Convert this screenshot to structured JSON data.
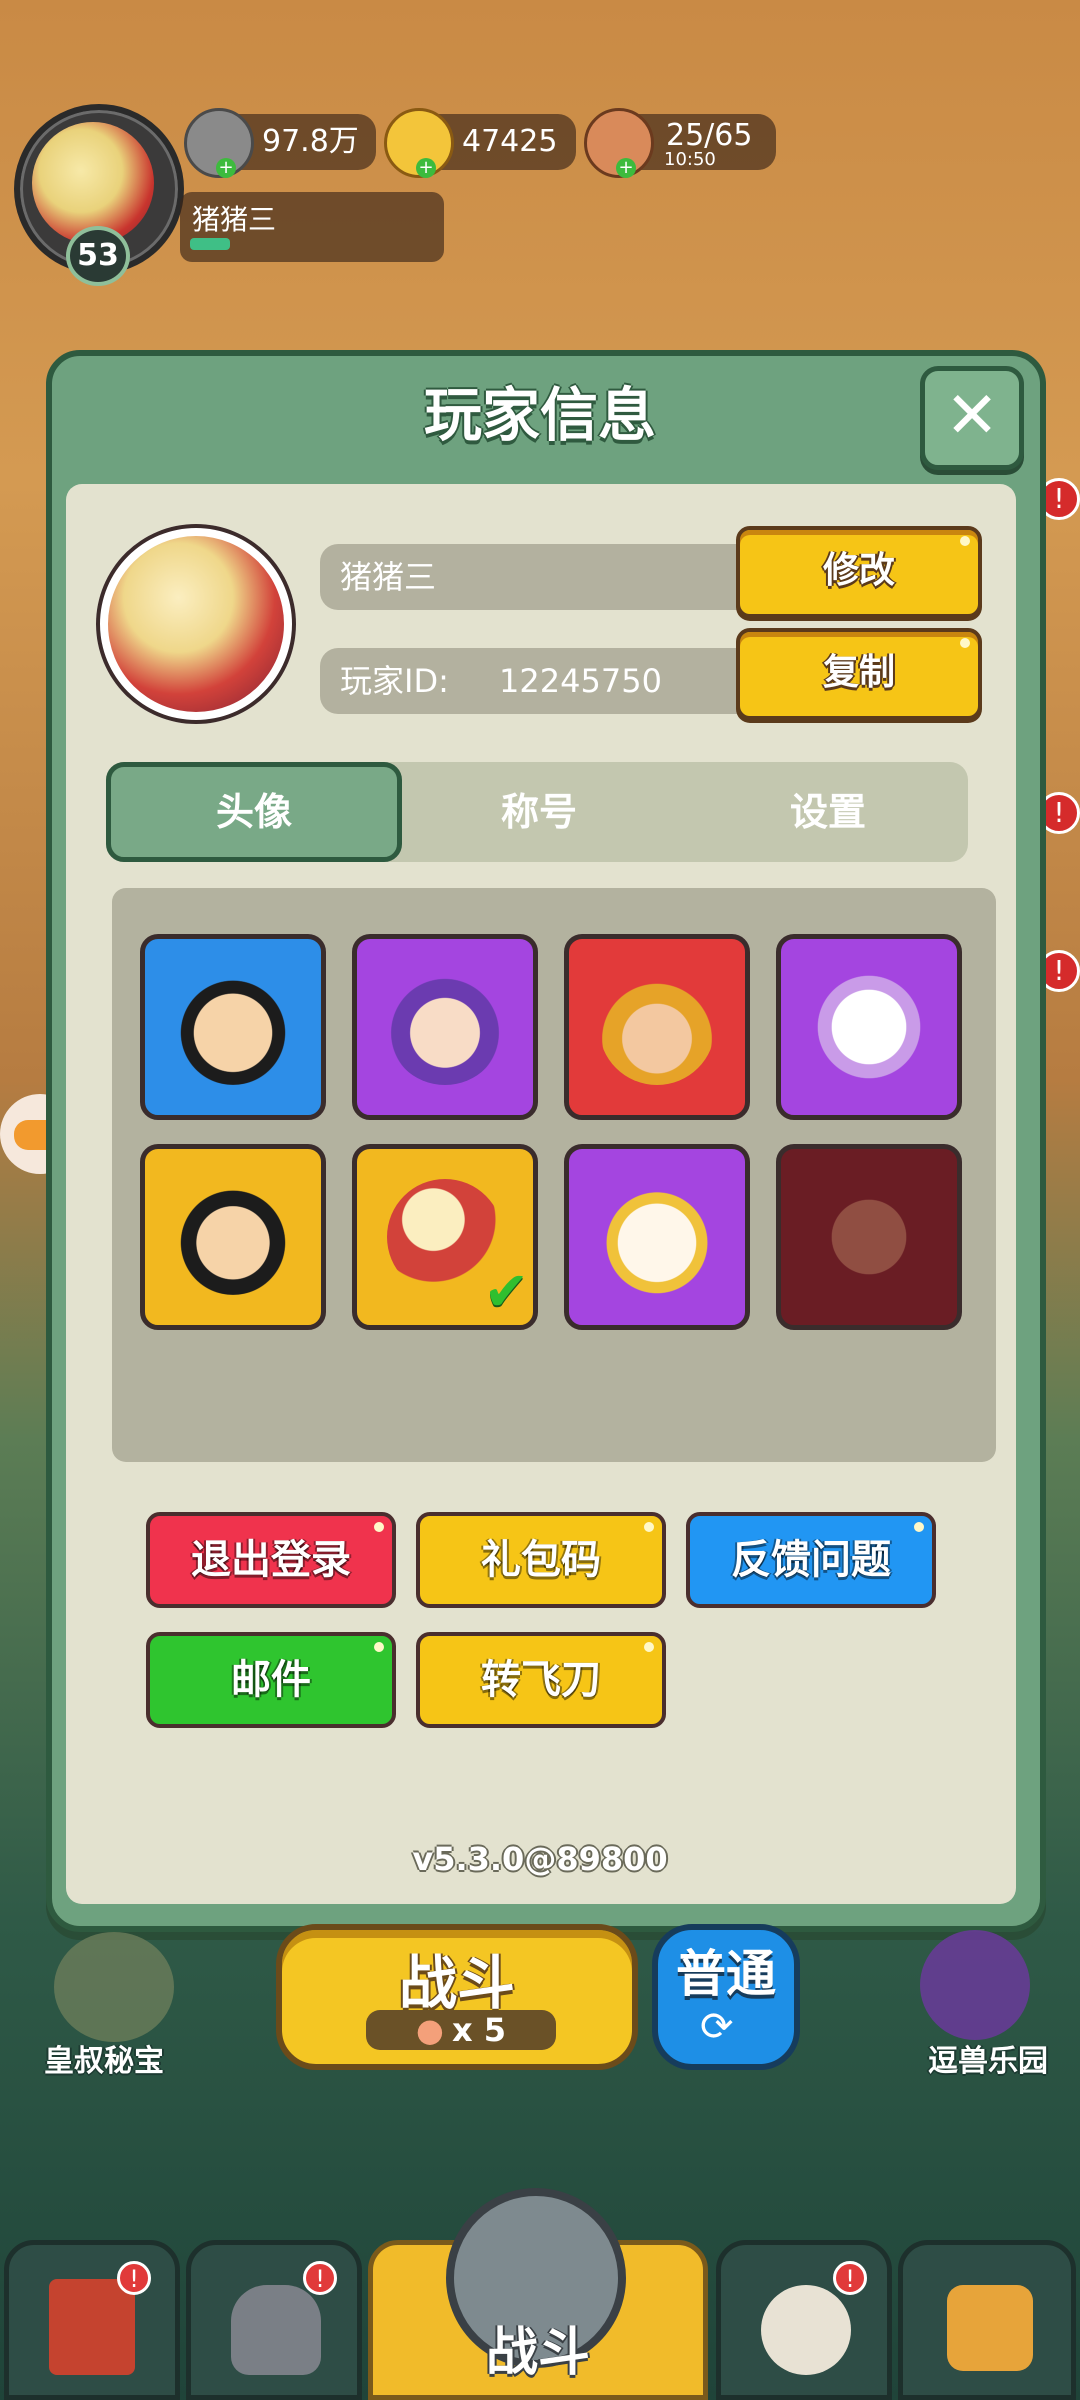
{
  "header": {
    "level": "53",
    "player_name": "猪猪三",
    "silver": "97.8万",
    "gold": "47425",
    "stamina": "25/65",
    "stamina_timer": "10:50"
  },
  "modal": {
    "title": "玩家信息",
    "name_value": "猪猪三",
    "edit_label": "修改",
    "id_label": "玩家ID:",
    "id_value": "12245750",
    "copy_label": "复制",
    "tabs": [
      {
        "label": "头像",
        "active": true
      },
      {
        "label": "称号",
        "active": false
      },
      {
        "label": "设置",
        "active": false
      }
    ],
    "avatars": [
      {
        "icon": "warrior-green-headband-icon",
        "bg": "#2d8ee8"
      },
      {
        "icon": "purple-hair-heroine-icon",
        "bg": "#a445e0"
      },
      {
        "icon": "red-armor-warrior-icon",
        "bg": "#e23a3a"
      },
      {
        "icon": "unicorn-icon",
        "bg": "#a445e0"
      },
      {
        "icon": "sunglasses-man-icon",
        "bg": "#f2b81f"
      },
      {
        "icon": "palace-badge-icon",
        "bg": "#f2b81f",
        "selected": true
      },
      {
        "icon": "rabbit-icon",
        "bg": "#a445e0"
      },
      {
        "icon": "lucky-cat-icon",
        "bg": "#6a1d24",
        "locked": true
      }
    ],
    "buttons": {
      "logout": "退出登录",
      "gift_code": "礼包码",
      "feedback": "反馈问题",
      "mail": "邮件",
      "transfer": "转飞刀"
    },
    "version": "v5.3.0@89800"
  },
  "bottom": {
    "battle_label": "战斗",
    "battle_cost": "x 5",
    "mode_label": "普通",
    "left_feature": "皇叔秘宝",
    "right_feature": "逗兽乐园",
    "nav_center_label": "战斗"
  },
  "colors": {
    "modal_green": "#6ea27f",
    "button_yellow": "#f6c516",
    "button_red": "#f0334d",
    "button_blue": "#2196f3",
    "button_green": "#2fc52f"
  }
}
